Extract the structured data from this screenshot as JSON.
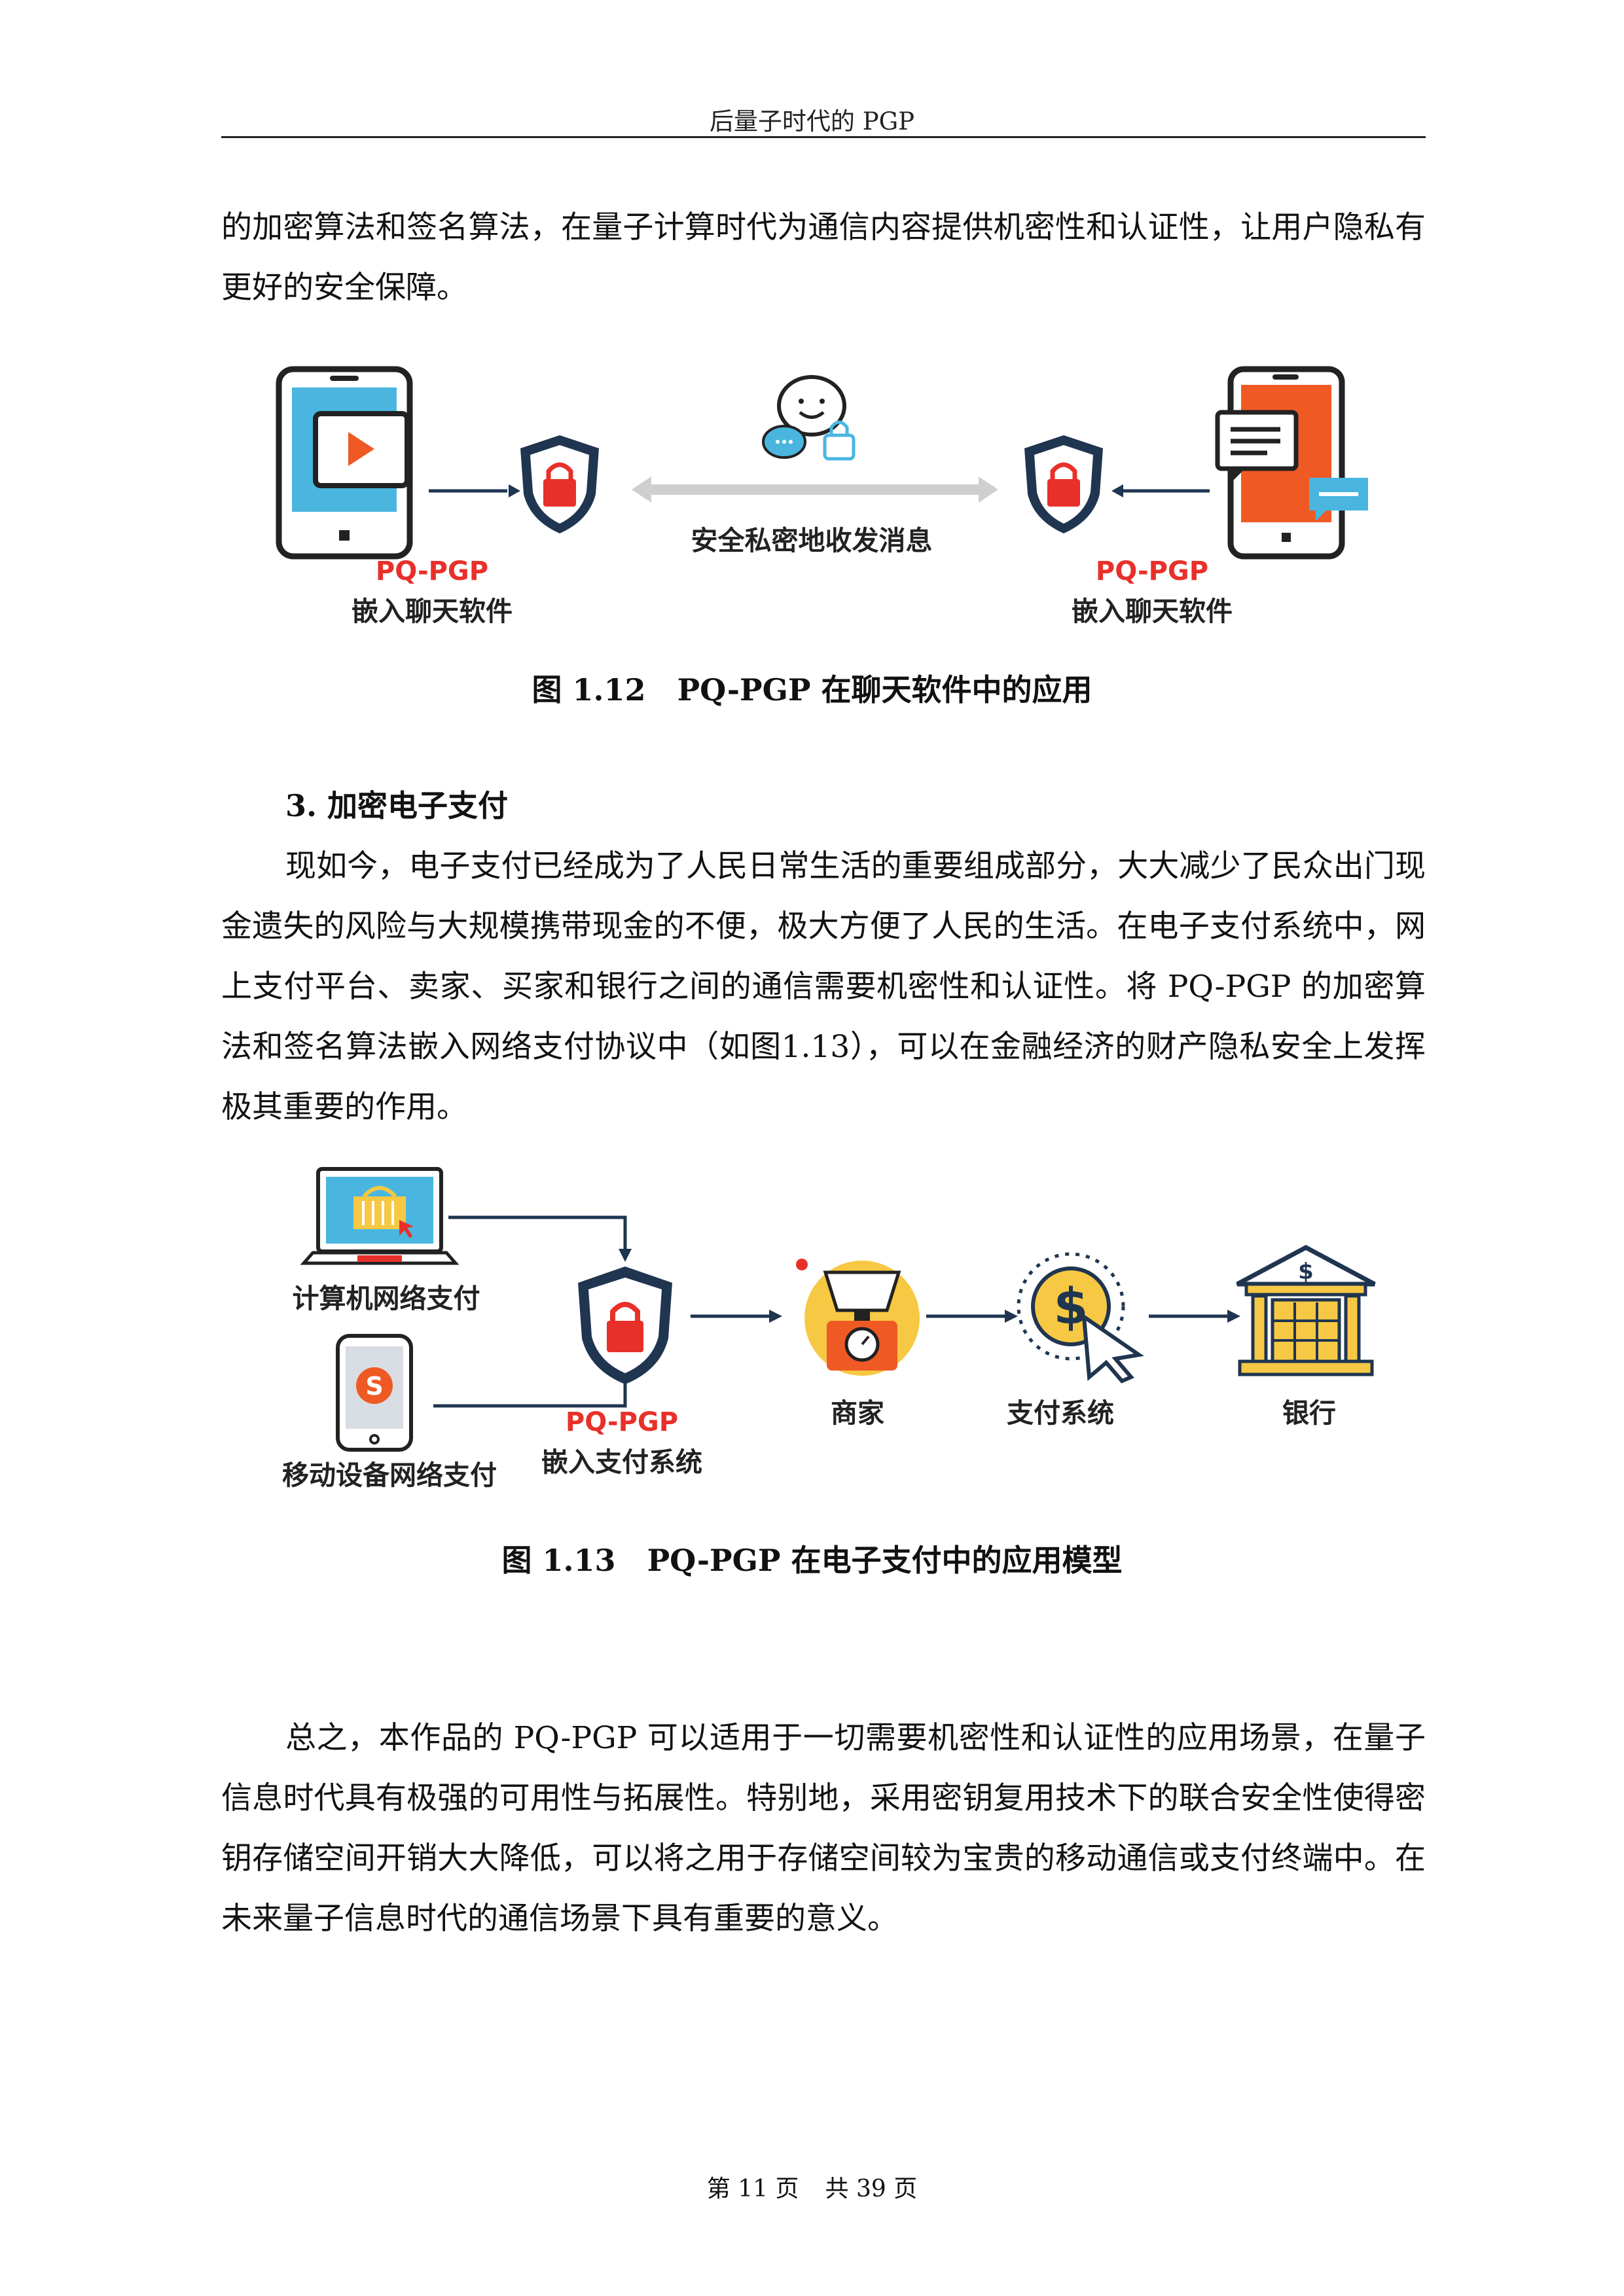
{
  "header": {
    "title": "后量子时代的 PGP"
  },
  "paragraphs": {
    "intro": "的加密算法和签名算法，在量子计算时代为通信内容提供机密性和认证性，让用户隐私有更好的安全保障。",
    "payment": "现如今，电子支付已经成为了人民日常生活的重要组成部分，大大减少了民众出门现金遗失的风险与大规模携带现金的不便，极大方便了人民的生活。在电子支付系统中，网上支付平台、卖家、买家和银行之间的通信需要机密性和认证性。将 PQ-PGP 的加密算法和签名算法嵌入网络支付协议中（如图1.13），可以在金融经济的财产隐私安全上发挥极其重要的作用。",
    "summary": "总之，本作品的 PQ-PGP 可以适用于一切需要机密性和认证性的应用场景，在量子信息时代具有极强的可用性与拓展性。特别地，采用密钥复用技术下的联合安全性使得密钥存储空间开销大大降低，可以将之用于存储空间较为宝贵的移动通信或支付终端中。在未来量子信息时代的通信场景下具有重要的意义。"
  },
  "section": {
    "heading": "3. 加密电子支付"
  },
  "figure_chat": {
    "left_red": "PQ-PGP",
    "left_black": "嵌入聊天软件",
    "middle": "安全私密地收发消息",
    "right_red": "PQ-PGP",
    "right_black": "嵌入聊天软件",
    "caption_num": "图 1.12",
    "caption_text": "PQ-PGP 在聊天软件中的应用"
  },
  "figure_pay": {
    "computer": "计算机网络支付",
    "mobile": "移动设备网络支付",
    "pgp_red": "PQ-PGP",
    "pgp_black": "嵌入支付系统",
    "merchant": "商家",
    "system": "支付系统",
    "bank": "银行",
    "caption_num": "图 1.13",
    "caption_text": "PQ-PGP 在电子支付中的应用模型"
  },
  "footer": {
    "page": "第 11 页",
    "total": "共 39 页"
  },
  "colors": {
    "red": "#e8302a",
    "navy": "#1f3550",
    "blue": "#3fa9d6",
    "orange": "#ef5a24",
    "yellow": "#f7c843"
  }
}
